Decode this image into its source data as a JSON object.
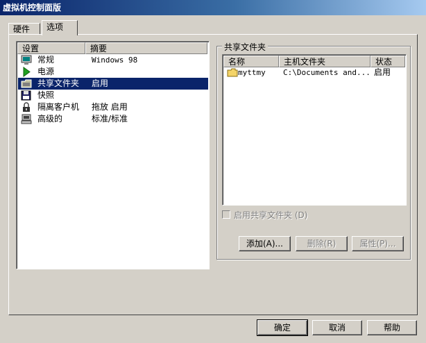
{
  "window": {
    "title": "虚拟机控制面版"
  },
  "tabs": [
    {
      "label": "硬件"
    },
    {
      "label": "选项"
    }
  ],
  "settings": {
    "headers": {
      "setting": "设置",
      "summary": "摘要"
    },
    "items": [
      {
        "icon": "monitor-icon",
        "name": "常规",
        "summary": "Windows 98"
      },
      {
        "icon": "play-icon",
        "name": "电源",
        "summary": ""
      },
      {
        "icon": "shared-folder-icon",
        "name": "共享文件夹",
        "summary": "启用",
        "selected": true
      },
      {
        "icon": "floppy-disk-icon",
        "name": "快照",
        "summary": ""
      },
      {
        "icon": "lock-icon",
        "name": "隔离客户机",
        "summary": "拖放 启用"
      },
      {
        "icon": "computer-icon",
        "name": "高级的",
        "summary": "标准/标准"
      }
    ]
  },
  "shared_folders": {
    "group_title": "共享文件夹",
    "headers": {
      "name": "名称",
      "host_folder": "主机文件夹",
      "status": "状态"
    },
    "rows": [
      {
        "name": "myttmy",
        "host_folder": "C:\\Documents and...",
        "status": "启用"
      }
    ],
    "enable_checkbox": {
      "label": "启用共享文件夹 (D)",
      "checked": false,
      "disabled": true
    },
    "buttons": {
      "add": "添加(A)...",
      "remove": "删除(R)",
      "properties": "属性(P)..."
    }
  },
  "dialog_buttons": {
    "ok": "确定",
    "cancel": "取消",
    "help": "帮助"
  },
  "colors": {
    "face": "#d4d0c8",
    "selection": "#0a246a",
    "title_start": "#0a246a",
    "title_end": "#a6caf0",
    "play_icon": "#20a020"
  }
}
